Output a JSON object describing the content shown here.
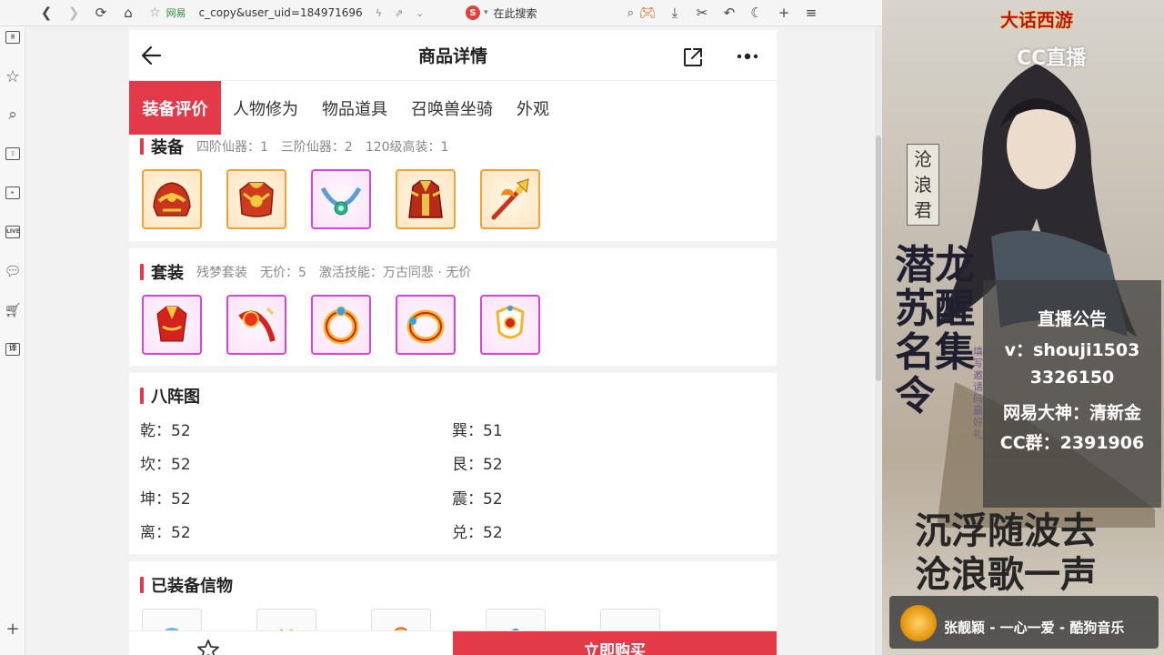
{
  "browser": {
    "site_label": "网易",
    "url_fragment": "c_copy&user_uid=184971696",
    "search_placeholder": "在此搜索"
  },
  "sidebar_icons": [
    "news-icon",
    "star-icon",
    "search-icon",
    "book-icon",
    "video-icon",
    "live-icon",
    "chat-icon",
    "cart-icon",
    "translate-icon",
    "plus-icon"
  ],
  "live_badge": "LIVE",
  "translate_glyph": "译",
  "header": {
    "title": "商品详情"
  },
  "tabs": [
    {
      "label": "装备评价",
      "active": true
    },
    {
      "label": "人物修为",
      "active": false
    },
    {
      "label": "物品道具",
      "active": false
    },
    {
      "label": "召唤兽坐骑",
      "active": false
    },
    {
      "label": "外观",
      "active": false
    }
  ],
  "equipment": {
    "title": "装备",
    "summary": "四阶仙器：1　三阶仙器：2　120级高装：1",
    "items": [
      "helmet-icon",
      "armor-icon",
      "necklace-icon",
      "robe-icon",
      "weapon-icon"
    ],
    "border_colors": [
      "orange",
      "orange",
      "purple",
      "orange",
      "orange"
    ]
  },
  "set": {
    "title": "套装",
    "summary": "残梦套装　无价：5　激活技能：万古同悲 · 无价",
    "items": [
      "robe-set-icon",
      "sash-icon",
      "ring-icon",
      "bracelet-icon",
      "amulet-icon"
    ]
  },
  "bagua": {
    "title": "八阵图",
    "left": [
      {
        "name": "乾：52"
      },
      {
        "name": "坎：52"
      },
      {
        "name": "坤：52"
      },
      {
        "name": "离：52"
      }
    ],
    "right": [
      {
        "name": "巽：51"
      },
      {
        "name": "艮：52"
      },
      {
        "name": "震：52"
      },
      {
        "name": "兑：52"
      }
    ]
  },
  "tokens": {
    "title": "已装备信物"
  },
  "bottom": {
    "buy_label": "立即购买"
  },
  "stream": {
    "game_logo": "大话西游",
    "cc_logo": "CC直播",
    "name_tag": [
      "沧",
      "浪",
      "君"
    ],
    "vertical_title": [
      "潜龙",
      "苏醒",
      "名集",
      "令"
    ],
    "vertical_sub": "填写邀请码赢好礼",
    "notice": [
      "直播公告",
      "v：shouji1503",
      "3326150",
      "网易大神：清新金",
      "CC群：2391906"
    ],
    "poem": [
      "沉浮随波去",
      "沧浪歌一声"
    ],
    "music": "张靓颖 - 一心一爱 - 酷狗音乐"
  },
  "colors": {
    "accent": "#e23a48",
    "orange_border": "#f0a13a",
    "purple_border": "#d347d8"
  }
}
